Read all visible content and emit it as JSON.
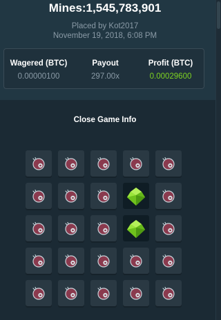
{
  "title": "Mines:1,545,783,901",
  "placed_by": "Placed by Kot2017",
  "date": "November 19, 2018, 6:08 PM",
  "stats": {
    "wagered_label": "Wagered (BTC)",
    "wagered_value": "0.00000100",
    "payout_label": "Payout",
    "payout_value": "297.00x",
    "profit_label": "Profit (BTC)",
    "profit_value": "0.00029600"
  },
  "close_label": "Close Game Info",
  "colors": {
    "profit": "#7ed321",
    "gem": "#7ed321",
    "mine": "#8a3a4e"
  },
  "grid": {
    "rows": 5,
    "cols": 5,
    "cells": [
      [
        "mine",
        "mine",
        "mine",
        "mine",
        "mine"
      ],
      [
        "mine",
        "mine",
        "mine",
        "gem",
        "mine"
      ],
      [
        "mine",
        "mine",
        "mine",
        "gem",
        "mine"
      ],
      [
        "mine",
        "mine",
        "mine",
        "mine",
        "mine"
      ],
      [
        "mine",
        "mine",
        "mine",
        "mine",
        "mine"
      ]
    ],
    "icons": {
      "mine": "mine-icon",
      "gem": "gem-icon"
    }
  }
}
